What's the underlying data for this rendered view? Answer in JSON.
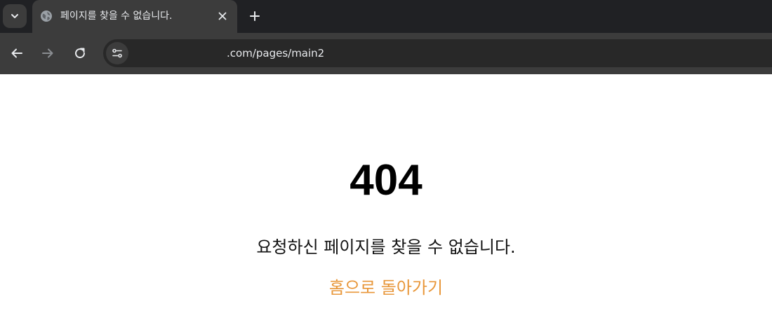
{
  "browser": {
    "tab": {
      "title": "페이지를 찾을 수 없습니다."
    },
    "address_bar": {
      "url": ".com/pages/main2"
    },
    "icons": {
      "tab_search": "chevron-down-icon",
      "favicon": "globe-icon",
      "tab_close": "close-icon",
      "new_tab": "plus-icon",
      "back": "arrow-left-icon",
      "forward": "arrow-right-icon",
      "reload": "reload-icon",
      "site_info": "tune-icon"
    },
    "colors": {
      "tabstrip_bg": "#202124",
      "toolbar_bg": "#3c3c3c",
      "omnibox_bg": "#282828",
      "text_light": "#e8eaed"
    }
  },
  "page": {
    "error_code": "404",
    "message": "요청하신 페이지를 찾을 수 없습니다.",
    "home_link": "홈으로 돌아가기",
    "colors": {
      "link": "#e8973a",
      "text": "#111111"
    }
  }
}
